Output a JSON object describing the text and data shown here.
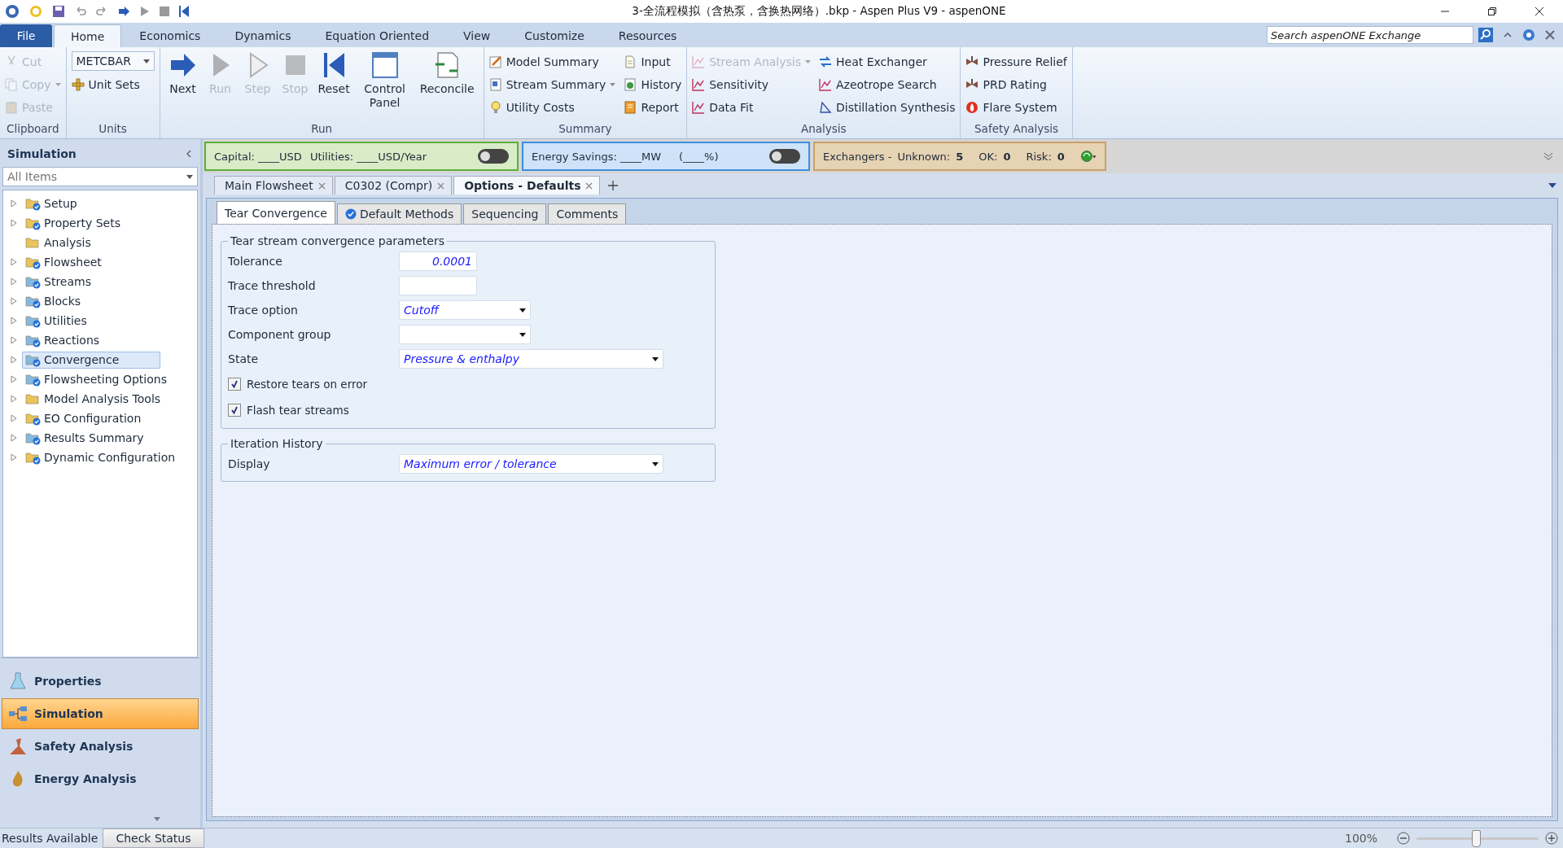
{
  "window": {
    "title": "3-全流程模拟（含热泵，含换热网络）.bkp - Aspen Plus V9 - aspenONE"
  },
  "ribbon": {
    "file_tab": "File",
    "tabs": [
      {
        "label": "Home",
        "selected": true
      },
      {
        "label": "Economics",
        "selected": false
      },
      {
        "label": "Dynamics",
        "selected": false
      },
      {
        "label": "Equation Oriented",
        "selected": false
      },
      {
        "label": "View",
        "selected": false
      },
      {
        "label": "Customize",
        "selected": false
      },
      {
        "label": "Resources",
        "selected": false
      }
    ],
    "search": {
      "placeholder": "Search aspenONE Exchange"
    },
    "groups": [
      {
        "label": "Clipboard",
        "items": [
          {
            "label": "Cut",
            "kind": "small",
            "disabled": true
          },
          {
            "label": "Copy",
            "kind": "split",
            "disabled": true
          },
          {
            "label": "Paste",
            "kind": "small",
            "disabled": true
          }
        ]
      },
      {
        "label": "Units",
        "items": [
          {
            "label": "METCBAR",
            "kind": "combo"
          },
          {
            "label": "Unit Sets",
            "kind": "small",
            "disabled": false
          }
        ]
      },
      {
        "label": "Run",
        "items": [
          {
            "label": "Next",
            "kind": "large",
            "disabled": false
          },
          {
            "label": "Run",
            "kind": "large",
            "disabled": true
          },
          {
            "label": "Step",
            "kind": "large",
            "disabled": true
          },
          {
            "label": "Stop",
            "kind": "large",
            "disabled": true
          },
          {
            "label": "Reset",
            "kind": "large",
            "disabled": false
          },
          {
            "label": "Control Panel",
            "kind": "large",
            "disabled": false
          },
          {
            "label": "Reconcile",
            "kind": "large",
            "disabled": false
          }
        ]
      },
      {
        "label": "Summary",
        "items": [
          {
            "label": "Model Summary",
            "kind": "small",
            "disabled": false
          },
          {
            "label": "Stream Summary",
            "kind": "split",
            "disabled": false
          },
          {
            "label": "Utility Costs",
            "kind": "small",
            "disabled": false
          },
          {
            "label": "Input",
            "kind": "small",
            "disabled": false
          },
          {
            "label": "History",
            "kind": "small",
            "disabled": false
          },
          {
            "label": "Report",
            "kind": "small",
            "disabled": false
          }
        ]
      },
      {
        "label": "Analysis",
        "items": [
          {
            "label": "Stream Analysis",
            "kind": "split",
            "disabled": true
          },
          {
            "label": "Sensitivity",
            "kind": "small",
            "disabled": false
          },
          {
            "label": "Data Fit",
            "kind": "small",
            "disabled": false
          },
          {
            "label": "Heat Exchanger",
            "kind": "small",
            "disabled": false
          },
          {
            "label": "Azeotrope Search",
            "kind": "small",
            "disabled": false
          },
          {
            "label": "Distillation Synthesis",
            "kind": "small",
            "disabled": false
          }
        ]
      },
      {
        "label": "Safety Analysis",
        "items": [
          {
            "label": "Pressure Relief",
            "kind": "small",
            "disabled": false
          },
          {
            "label": "PRD Rating",
            "kind": "small",
            "disabled": false
          },
          {
            "label": "Flare System",
            "kind": "small",
            "disabled": false
          }
        ]
      }
    ]
  },
  "indicators": {
    "capital": {
      "label": "Capital: ____USD",
      "utilities": "Utilities: ____USD/Year",
      "on": false
    },
    "energy": {
      "label": "Energy Savings: ____MW",
      "percent": "(____%)",
      "on": false
    },
    "exchangers": {
      "label": "Exchangers -",
      "counts": [
        {
          "label": "Unknown:",
          "value": "5"
        },
        {
          "label": "OK:",
          "value": "0"
        },
        {
          "label": "Risk:",
          "value": "0"
        }
      ]
    }
  },
  "sidebar": {
    "title": "Simulation",
    "filter": "All Items",
    "items": [
      {
        "label": "Setup",
        "expandable": true,
        "checked": true,
        "selected": false,
        "color": "#e9c45c"
      },
      {
        "label": "Property Sets",
        "expandable": true,
        "checked": true,
        "selected": false,
        "color": "#e9c45c"
      },
      {
        "label": "Analysis",
        "expandable": false,
        "checked": false,
        "selected": false,
        "color": "#e9c45c"
      },
      {
        "label": "Flowsheet",
        "expandable": true,
        "checked": true,
        "selected": false,
        "color": "#e9c45c"
      },
      {
        "label": "Streams",
        "expandable": true,
        "checked": true,
        "selected": false,
        "color": "#86b9e0"
      },
      {
        "label": "Blocks",
        "expandable": true,
        "checked": true,
        "selected": false,
        "color": "#86b9e0"
      },
      {
        "label": "Utilities",
        "expandable": true,
        "checked": true,
        "selected": false,
        "color": "#86b9e0"
      },
      {
        "label": "Reactions",
        "expandable": true,
        "checked": true,
        "selected": false,
        "color": "#86b9e0"
      },
      {
        "label": "Convergence",
        "expandable": true,
        "checked": true,
        "selected": true,
        "color": "#86b9e0"
      },
      {
        "label": "Flowsheeting Options",
        "expandable": true,
        "checked": true,
        "selected": false,
        "color": "#86b9e0"
      },
      {
        "label": "Model Analysis Tools",
        "expandable": true,
        "checked": false,
        "selected": false,
        "color": "#e9c45c"
      },
      {
        "label": "EO Configuration",
        "expandable": true,
        "checked": true,
        "selected": false,
        "color": "#e9c45c"
      },
      {
        "label": "Results Summary",
        "expandable": true,
        "checked": true,
        "selected": false,
        "color": "#86b9e0"
      },
      {
        "label": "Dynamic Configuration",
        "expandable": true,
        "checked": true,
        "selected": false,
        "color": "#e9c45c"
      }
    ],
    "nav": [
      {
        "label": "Properties",
        "selected": false
      },
      {
        "label": "Simulation",
        "selected": true
      },
      {
        "label": "Safety Analysis",
        "selected": false
      },
      {
        "label": "Energy Analysis",
        "selected": false
      }
    ]
  },
  "doc_tabs": [
    {
      "label": "Main Flowsheet",
      "selected": false
    },
    {
      "label": "C0302 (Compr)",
      "selected": false
    },
    {
      "label": "Options - Defaults",
      "selected": true
    }
  ],
  "form_tabs": [
    {
      "label": "Tear Convergence",
      "selected": true,
      "complete": false
    },
    {
      "label": "Default Methods",
      "selected": false,
      "complete": true
    },
    {
      "label": "Sequencing",
      "selected": false,
      "complete": false
    },
    {
      "label": "Comments",
      "selected": false,
      "complete": false
    }
  ],
  "sections": [
    {
      "title": "Tear stream convergence parameters",
      "fields": [
        {
          "label": "Tolerance",
          "kind": "number",
          "value": "0.0001"
        },
        {
          "label": "Trace threshold",
          "kind": "number"
        },
        {
          "label": "Trace option",
          "kind": "dropdown",
          "value": "Cutoff"
        },
        {
          "label": "Component group",
          "kind": "dropdown"
        },
        {
          "label": "State",
          "kind": "wide-dropdown",
          "value": "Pressure & enthalpy"
        },
        {
          "label": "Restore tears on error",
          "kind": "checkbox",
          "checked": true
        },
        {
          "label": "Flash tear streams",
          "kind": "checkbox",
          "checked": true
        }
      ]
    },
    {
      "title": "Iteration History",
      "fields": [
        {
          "label": "Display",
          "kind": "wide-dropdown",
          "value": "Maximum error / tolerance"
        }
      ]
    }
  ],
  "status_bar": {
    "message": "Results Available",
    "button": "Check Status",
    "zoom": "100%",
    "zoom_slider": {
      "level": 0.48
    }
  }
}
